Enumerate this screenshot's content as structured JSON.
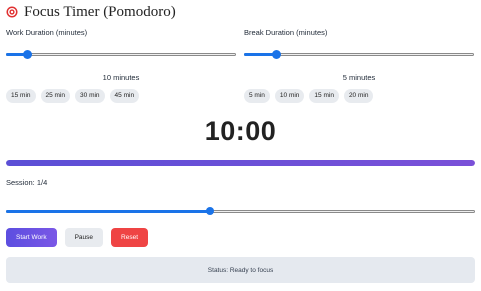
{
  "app": {
    "title": "Focus Timer (Pomodoro)",
    "icon": "target-icon"
  },
  "work": {
    "label": "Work Duration (minutes)",
    "value_text": "10 minutes",
    "slider_value": 10,
    "slider_min": 5,
    "slider_max": 60,
    "presets": [
      "15 min",
      "25 min",
      "30 min",
      "45 min"
    ]
  },
  "break_section": {
    "label": "Break Duration (minutes)",
    "value_text": "5 minutes",
    "slider_value": 5,
    "slider_min": 1,
    "slider_max": 30,
    "presets": [
      "5 min",
      "10 min",
      "15 min",
      "20 min"
    ]
  },
  "timer": {
    "display": "10:00",
    "progress_percent": 100
  },
  "session": {
    "label": "Session: 1/4",
    "slider_value": 1,
    "slider_min": 0,
    "slider_max": 2.3
  },
  "buttons": {
    "start": "Start Work",
    "pause": "Pause",
    "reset": "Reset"
  },
  "status": {
    "text": "Status: Ready to focus"
  },
  "colors": {
    "accent": "#1a73e8",
    "primary": "#5c4ee0",
    "danger": "#ef4444"
  }
}
